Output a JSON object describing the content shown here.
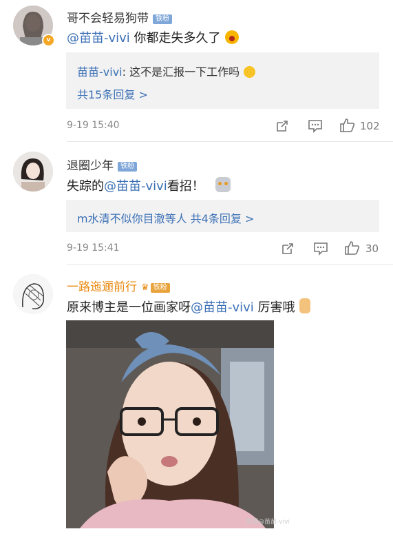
{
  "comments": [
    {
      "username": "哥不会轻易狗带",
      "fan_badge": "铁粉",
      "mention": "@苗苗-vivi",
      "text": " 你都走失多久了",
      "reply_author": "苗苗-vivi",
      "reply_text": ": 这不是汇报一下工作吗",
      "more_replies": "共15条回复 >",
      "time": "9-19 15:40",
      "likes": "102"
    },
    {
      "username": "退圈少年",
      "fan_badge": "铁粉",
      "text_before": "失踪的",
      "mention": "@苗苗-vivi",
      "text_after": "看招！",
      "reply_line": "m水清不似你目澈等人 共4条回复 >",
      "time": "9-19 15:41",
      "likes": "30"
    },
    {
      "username": "一路迤逦前行",
      "fan_badge": "铁粉",
      "text_before": "原来博主是一位画家呀",
      "mention": "@苗苗-vivi",
      "text_after": " 厉害哦"
    }
  ],
  "watermark": "微博@苗苗-vivi",
  "colors": {
    "link": "#3a6fb5",
    "orange_name": "#e8880d",
    "reply_bg": "#f2f2f2"
  }
}
